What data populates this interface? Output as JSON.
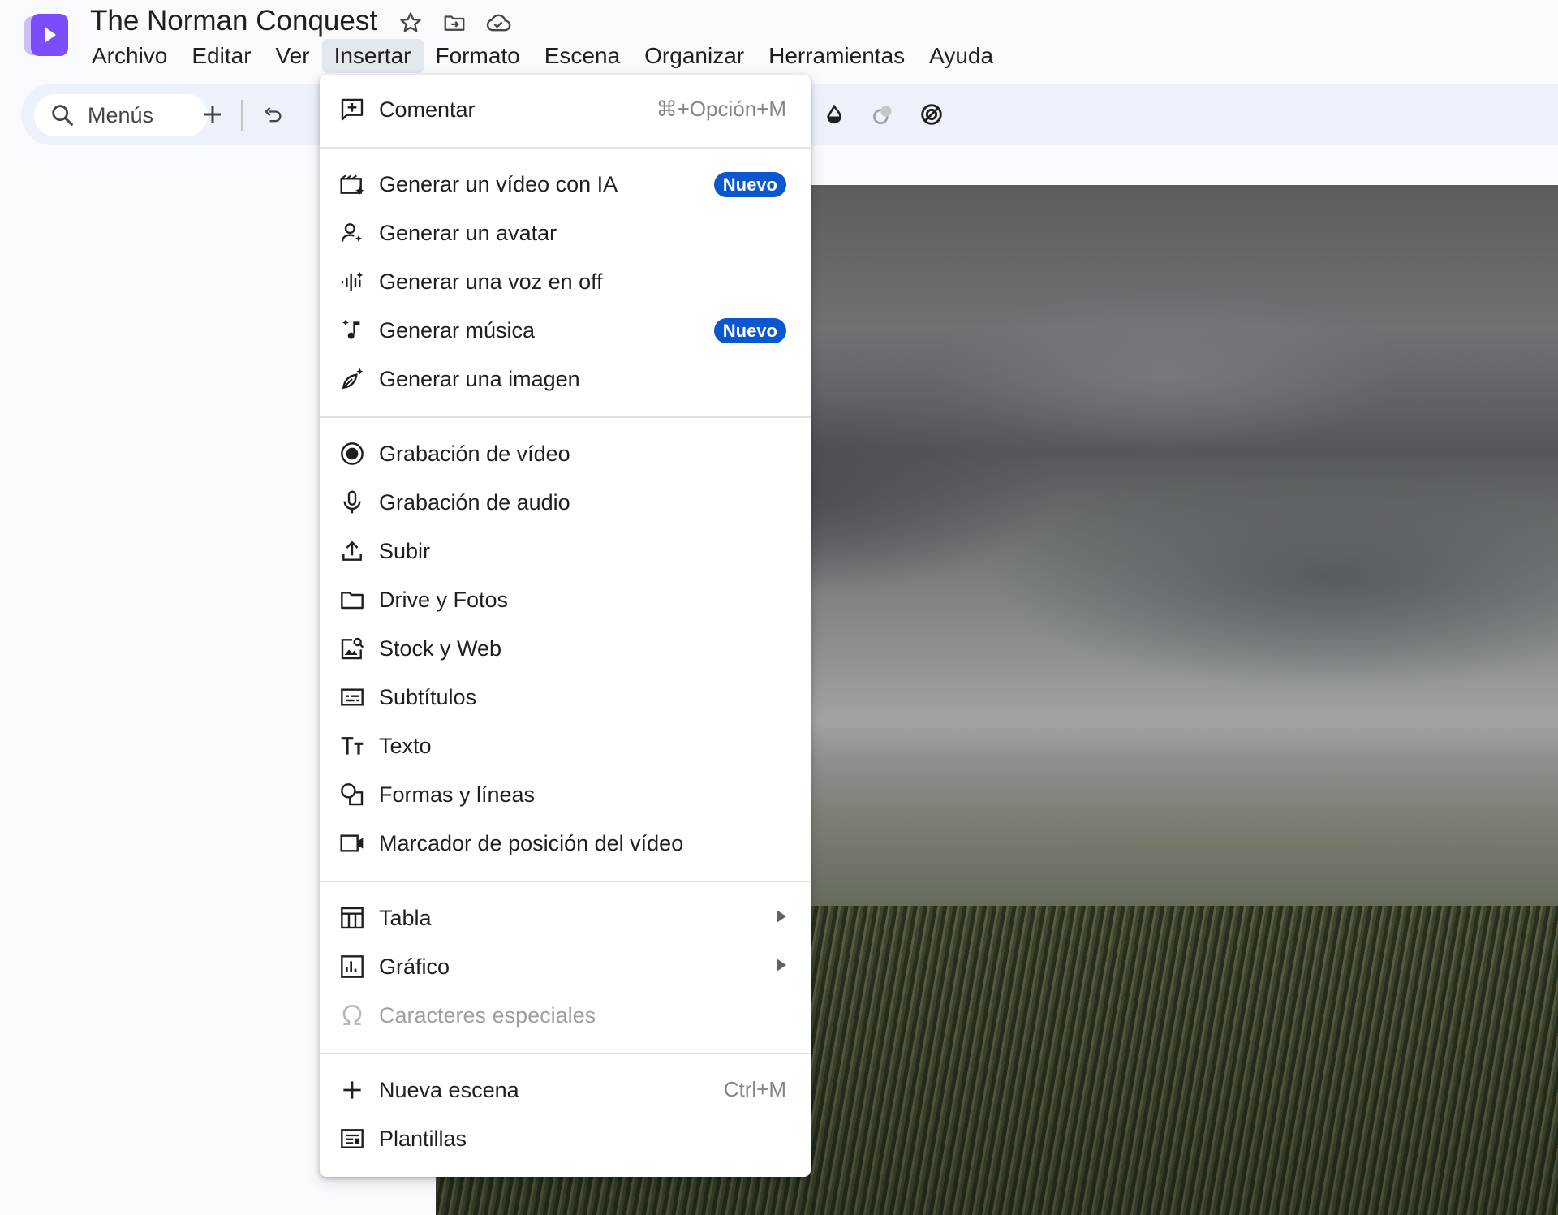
{
  "header": {
    "title": "The Norman Conquest",
    "icons": [
      "star-icon",
      "move-to-folder-icon",
      "cloud-saved-icon"
    ]
  },
  "menubar": {
    "items": [
      "Archivo",
      "Editar",
      "Ver",
      "Insertar",
      "Formato",
      "Escena",
      "Organizar",
      "Herramientas",
      "Ayuda"
    ],
    "active": "Insertar"
  },
  "toolbar": {
    "search_label": "Menús"
  },
  "insert_menu": {
    "comment": {
      "label": "Comentar",
      "shortcut": "⌘+Opción+M",
      "icon": "add-comment-icon"
    },
    "ai_video": {
      "label": "Generar un vídeo con IA",
      "badge": "Nuevo",
      "icon": "ai-video-icon"
    },
    "avatar": {
      "label": "Generar un avatar",
      "icon": "ai-avatar-icon"
    },
    "voiceover": {
      "label": "Generar una voz en off",
      "icon": "ai-voice-icon"
    },
    "music": {
      "label": "Generar música",
      "badge": "Nuevo",
      "icon": "ai-music-icon"
    },
    "image": {
      "label": "Generar una imagen",
      "icon": "ai-image-icon"
    },
    "video_rec": {
      "label": "Grabación de vídeo",
      "icon": "record-icon"
    },
    "audio_rec": {
      "label": "Grabación de audio",
      "icon": "microphone-icon"
    },
    "upload": {
      "label": "Subir",
      "icon": "upload-icon"
    },
    "drive": {
      "label": "Drive y Fotos",
      "icon": "folder-icon"
    },
    "stock": {
      "label": "Stock y Web",
      "icon": "image-search-icon"
    },
    "subtitles": {
      "label": "Subtítulos",
      "icon": "subtitles-icon"
    },
    "text": {
      "label": "Texto",
      "icon": "text-icon"
    },
    "shapes": {
      "label": "Formas y líneas",
      "icon": "shapes-icon"
    },
    "placeholder": {
      "label": "Marcador de posición del vídeo",
      "icon": "video-camera-icon"
    },
    "table": {
      "label": "Tabla",
      "icon": "table-icon"
    },
    "chart": {
      "label": "Gráfico",
      "icon": "chart-icon"
    },
    "special_chars": {
      "label": "Caracteres especiales",
      "icon": "omega-icon",
      "disabled": true
    },
    "new_scene": {
      "label": "Nueva escena",
      "shortcut": "Ctrl+M",
      "icon": "plus-icon"
    },
    "templates": {
      "label": "Plantillas",
      "icon": "templates-icon"
    }
  },
  "colors": {
    "badge": "#0b57d0",
    "active_menu_bg": "#e3e7ee",
    "toolbar_bg": "#edf2fa",
    "app_logo": "#7c4dff"
  }
}
